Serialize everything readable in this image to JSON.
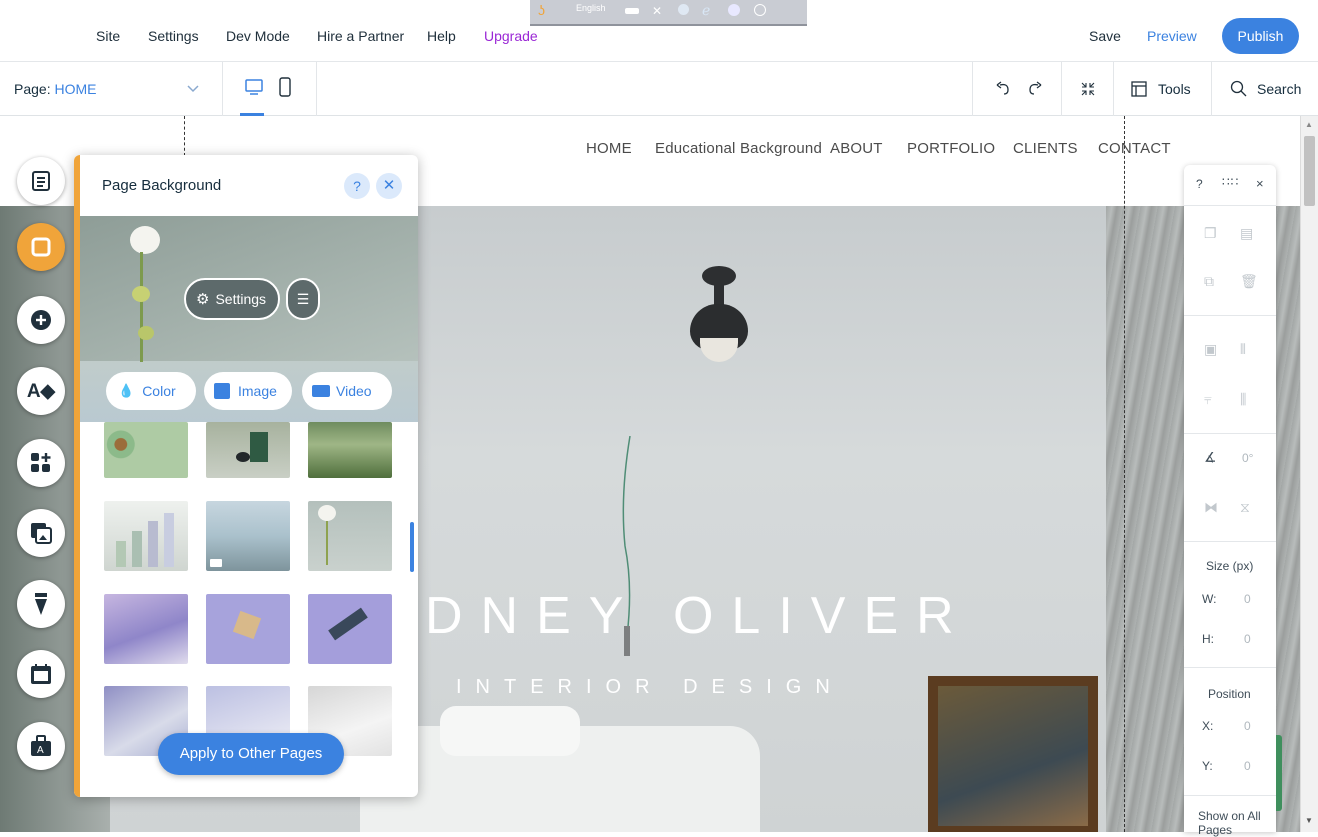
{
  "top_menu": {
    "items": [
      "Site",
      "Settings",
      "Dev Mode",
      "Hire a Partner",
      "Help",
      "Upgrade"
    ],
    "save": "Save",
    "preview": "Preview",
    "publish": "Publish",
    "os_strip_lang": "English"
  },
  "toolbar": {
    "page_label": "Page:",
    "page_name": "HOME",
    "tools": "Tools",
    "search": "Search"
  },
  "site": {
    "nav": [
      "HOME",
      "Educational Background",
      "ABOUT",
      "PORTFOLIO",
      "CLIENTS",
      "CONTACT"
    ],
    "hero_title": "DNEY OLIVER",
    "hero_subtitle": "INTERIOR DESIGN"
  },
  "panel": {
    "title": "Page Background",
    "help": "?",
    "settings": "Settings",
    "tabs": [
      "Color",
      "Image",
      "Video"
    ],
    "apply": "Apply to Other Pages"
  },
  "right_tools": {
    "help": "?",
    "close": "×",
    "rotation": "0°",
    "size_label": "Size (px)",
    "w_label": "W:",
    "w_value": "0",
    "h_label": "H:",
    "h_value": "0",
    "position_label": "Position",
    "x_label": "X:",
    "x_value": "0",
    "y_label": "Y:",
    "y_value": "0",
    "show_on_all": "Show on All Pages"
  },
  "colors": {
    "accent_blue": "#3b82e0",
    "accent_orange": "#f0a43a",
    "upgrade_purple": "#9a27d5"
  }
}
